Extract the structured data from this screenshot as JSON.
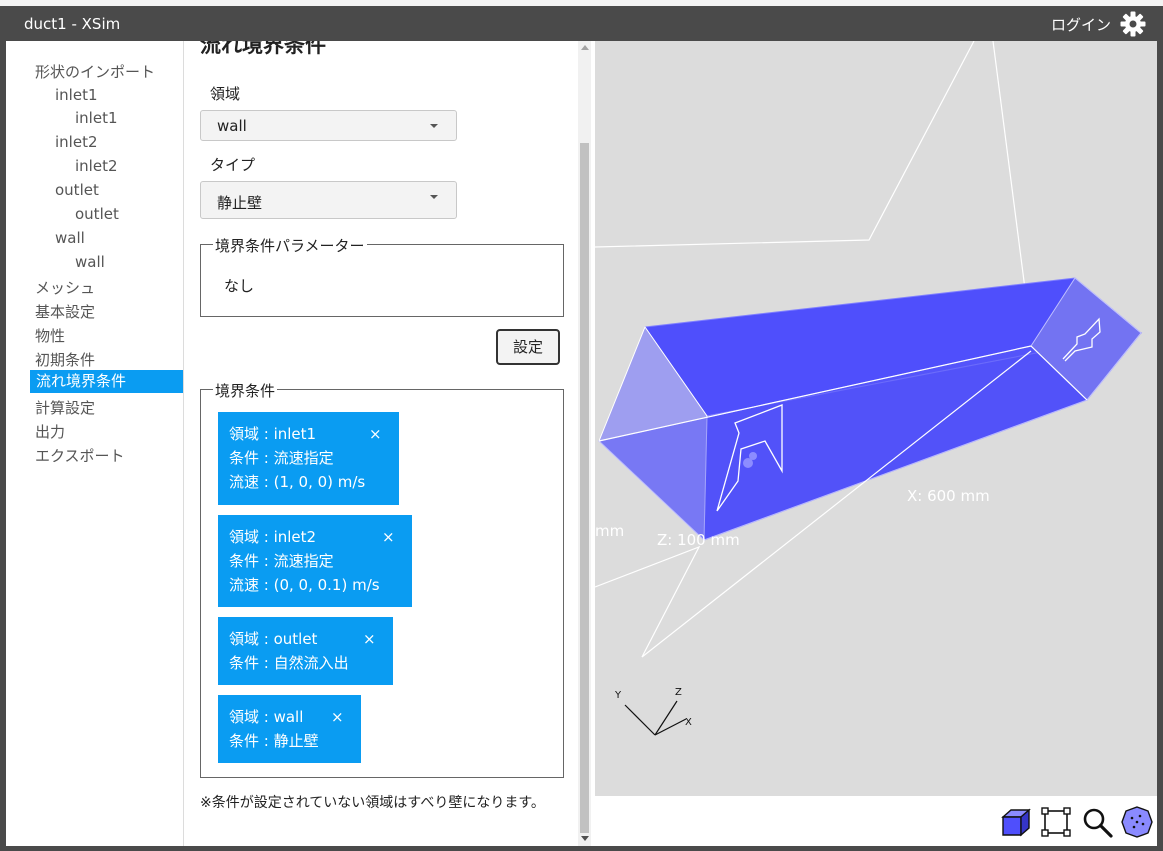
{
  "window": {
    "title": "duct1 - XSim",
    "login": "ログイン"
  },
  "nav": {
    "import": "形状のインポート",
    "inlet1_group": "inlet1",
    "inlet1_item": "inlet1",
    "inlet2_group": "inlet2",
    "inlet2_item": "inlet2",
    "outlet_group": "outlet",
    "outlet_item": "outlet",
    "wall_group": "wall",
    "wall_item": "wall",
    "mesh": "メッシュ",
    "basic": "基本設定",
    "property": "物性",
    "initial": "初期条件",
    "boundary": "流れ境界条件",
    "calc": "計算設定",
    "output": "出力",
    "export": "エクスポート"
  },
  "panel": {
    "title": "流れ境界条件",
    "region_label": "領域",
    "region_value": "wall",
    "type_label": "タイプ",
    "type_value": "静止壁",
    "params_legend": "境界条件パラメーター",
    "params_value": "なし",
    "set_button": "設定",
    "conditions_legend": "境界条件",
    "close_glyph": "×",
    "cards": [
      {
        "line1": "領域 : inlet1",
        "line2": "条件 : 流速指定",
        "line3": "流速 : (1, 0, 0) m/s"
      },
      {
        "line1": "領域 : inlet2",
        "line2": "条件 : 流速指定",
        "line3": "流速 : (0, 0, 0.1) m/s"
      },
      {
        "line1": "領域 : outlet",
        "line2": "条件 : 自然流入出"
      },
      {
        "line1": "領域 : wall",
        "line2": "条件 : 静止壁"
      }
    ],
    "note": "※条件が設定されていない領域はすべり壁になります。"
  },
  "viewport": {
    "dim_x": "X: 600 mm",
    "dim_z": "Z: 100 mm",
    "dim_partial": "mm",
    "axis_x": "X",
    "axis_y": "Y",
    "axis_z": "Z"
  },
  "colors": {
    "accent": "#0a9cf2",
    "model": "#4f4ffc",
    "titlebar": "#4a4a4a",
    "viewport": "#dcdcdc"
  },
  "icons": [
    "gear-icon",
    "cube-view-icon",
    "fit-frame-icon",
    "zoom-icon",
    "sphere-view-icon"
  ]
}
